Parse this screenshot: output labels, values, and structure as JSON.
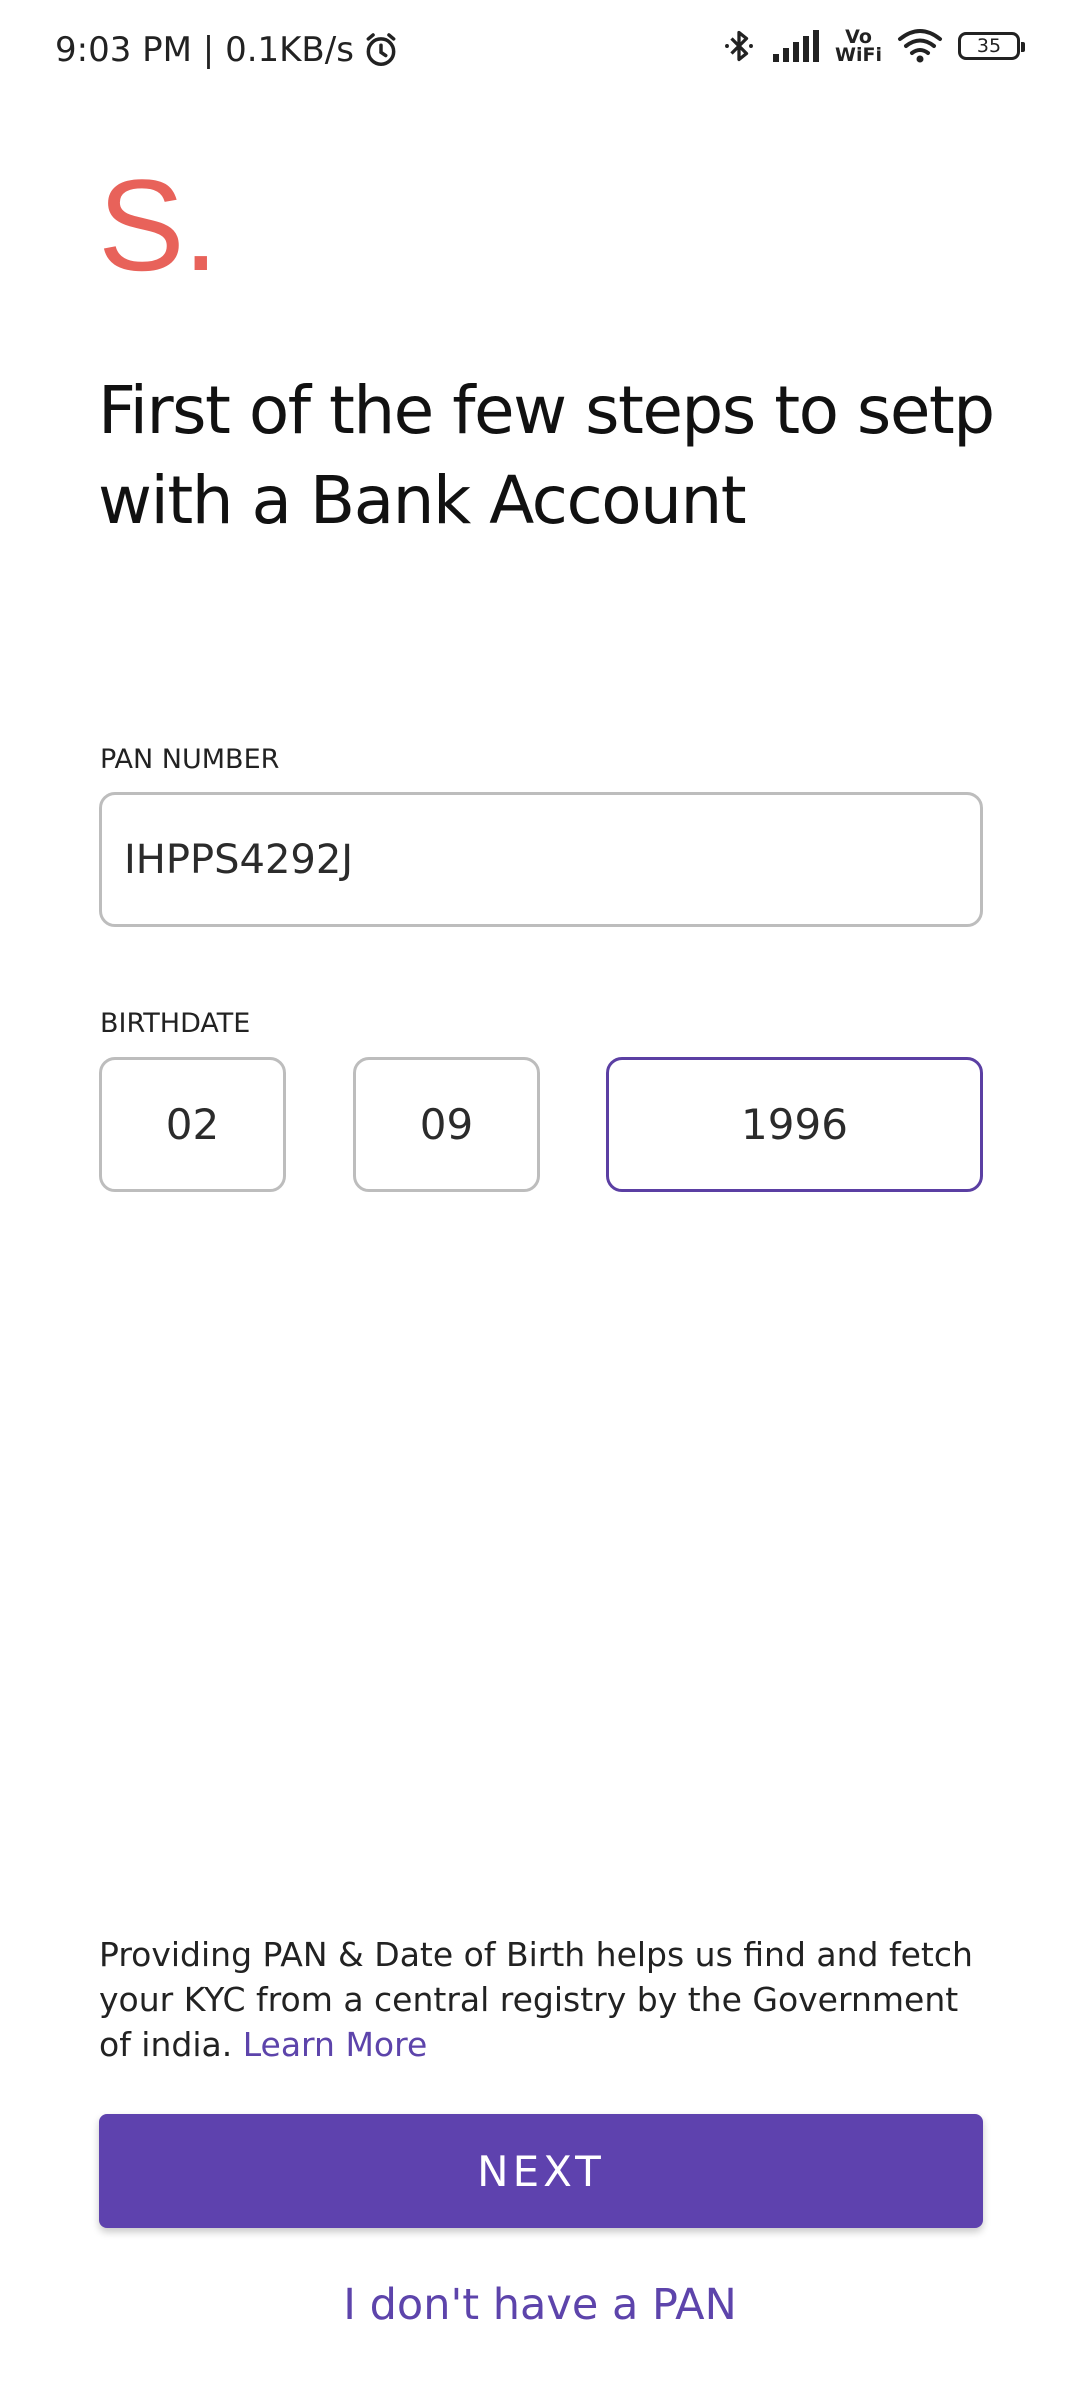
{
  "status_bar": {
    "time_speed": "9:03 PM | 0.1KB/s",
    "vowifi_top": "Vo",
    "vowifi_bottom": "WiFi",
    "battery": "35"
  },
  "logo": {
    "text": "S."
  },
  "heading": "First of the few steps to setp with a Bank Account",
  "pan": {
    "label": "PAN NUMBER",
    "value": "IHPPS4292J"
  },
  "birthdate": {
    "label": "BIRTHDATE",
    "day": "02",
    "month": "09",
    "year": "1996"
  },
  "info": {
    "text": "Providing PAN & Date of Birth helps us find and fetch your KYC from a central registry by the Government of india.",
    "learn_more": "Learn More"
  },
  "next_button": "NEXT",
  "no_pan_link": "I don't have a PAN",
  "colors": {
    "logo": "#e8625a",
    "accent": "#5e42ae",
    "link": "#5d44ab",
    "input_border": "#bdbdbd"
  }
}
